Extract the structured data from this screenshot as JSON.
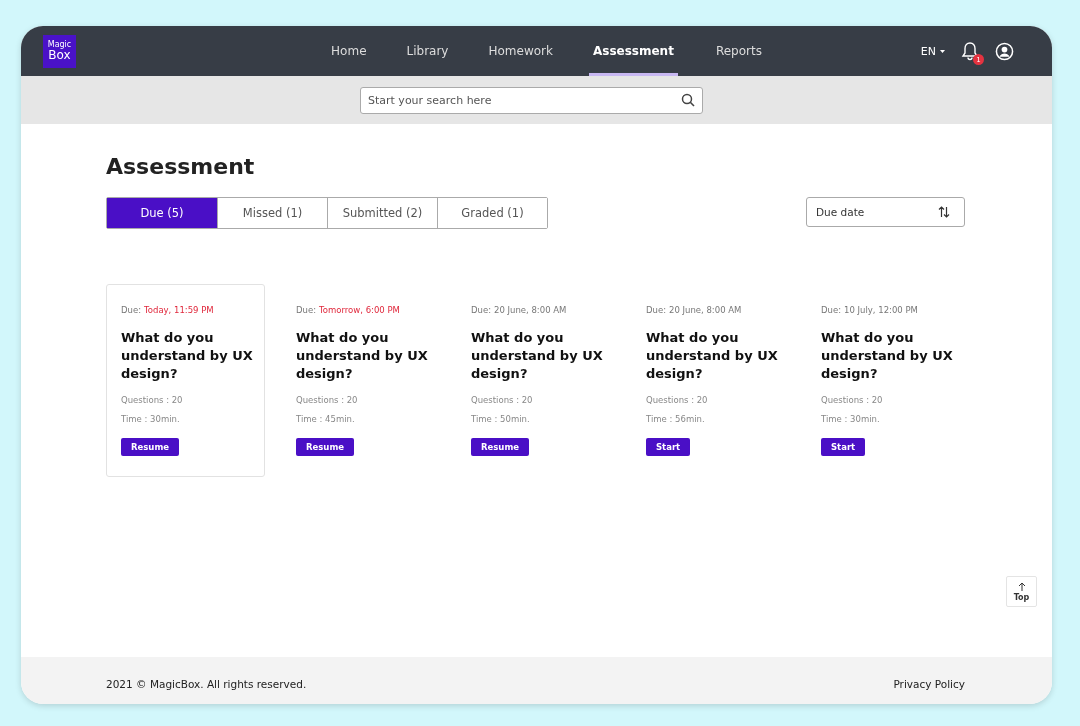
{
  "logo": {
    "line_1": "Magic",
    "line_2": "Box"
  },
  "nav": [
    {
      "label": "Home",
      "selected": false
    },
    {
      "label": "Library",
      "selected": false
    },
    {
      "label": "Homework",
      "selected": false
    },
    {
      "label": "Assessment",
      "selected": true
    },
    {
      "label": "Reports",
      "selected": false
    }
  ],
  "language": "EN",
  "notifications": {
    "count": "1"
  },
  "search": {
    "placeholder": "Start your search here"
  },
  "page_title": "Assessment",
  "tabs": [
    {
      "label": "Due (5)",
      "selected": true
    },
    {
      "label": "Missed (1)",
      "selected": false
    },
    {
      "label": "Submitted (2)",
      "selected": false
    },
    {
      "label": "Graded (1)",
      "selected": false
    }
  ],
  "sort": {
    "value": "Due date"
  },
  "cards": [
    {
      "due_label": "Due:",
      "due": "Today, 11:59 PM",
      "urgent": true,
      "selected": true,
      "title": "What do you understand by UX design?",
      "questions": "Questions : 20",
      "time": "Time : 30min.",
      "action": "Resume"
    },
    {
      "due_label": "Due:",
      "due": "Tomorrow, 6:00 PM",
      "urgent": true,
      "selected": false,
      "title": "What do you understand by UX design?",
      "questions": "Questions : 20",
      "time": "Time : 45min.",
      "action": "Resume"
    },
    {
      "due_label": "Due:",
      "due": "20 June, 8:00 AM",
      "urgent": false,
      "selected": false,
      "title": "What do you understand by UX design?",
      "questions": "Questions : 20",
      "time": "Time : 50min.",
      "action": "Resume"
    },
    {
      "due_label": "Due:",
      "due": "20 June, 8:00 AM",
      "urgent": false,
      "selected": false,
      "title": "What do you understand by UX design?",
      "questions": "Questions : 20",
      "time": "Time : 56min.",
      "action": "Start"
    },
    {
      "due_label": "Due:",
      "due": "10 July, 12:00 PM",
      "urgent": false,
      "selected": false,
      "title": "What do you understand by UX design?",
      "questions": "Questions : 20",
      "time": "Time : 30min.",
      "action": "Start"
    }
  ],
  "top_button": "Top",
  "footer": {
    "copyright": "2021 © MagicBox. All rights reserved.",
    "link": "Privacy Policy"
  }
}
